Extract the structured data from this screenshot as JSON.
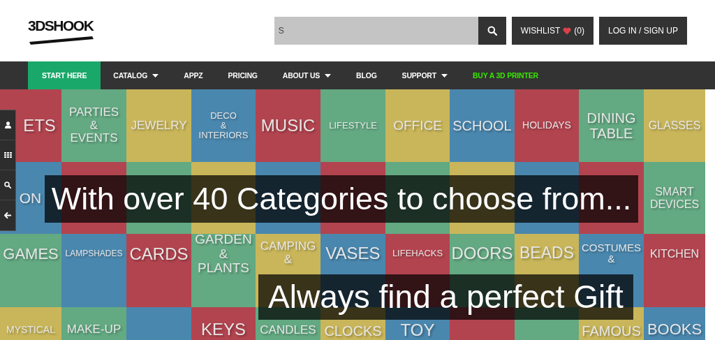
{
  "header": {
    "logo": "3DSHOOK",
    "search": {
      "placeholder": "S"
    },
    "wishlist": {
      "label": "WISHLIST",
      "count": "(0)"
    },
    "login": "LOG IN / SIGN UP"
  },
  "nav": [
    {
      "label": "START HERE",
      "selected": true,
      "dropdown": false,
      "highlight": false
    },
    {
      "label": "CATALOG",
      "selected": false,
      "dropdown": true,
      "highlight": false
    },
    {
      "label": "APPZ",
      "selected": false,
      "dropdown": false,
      "highlight": false
    },
    {
      "label": "PRICING",
      "selected": false,
      "dropdown": false,
      "highlight": false
    },
    {
      "label": "ABOUT US",
      "selected": false,
      "dropdown": true,
      "highlight": false
    },
    {
      "label": "BLOG",
      "selected": false,
      "dropdown": false,
      "highlight": false
    },
    {
      "label": "SUPPORT",
      "selected": false,
      "dropdown": true,
      "highlight": false
    },
    {
      "label": "BUY A 3D PRINTER",
      "selected": false,
      "dropdown": false,
      "highlight": true
    }
  ],
  "hero": {
    "rows": [
      {
        "tiles": [
          {
            "label": "ETS",
            "color": "#b2444f"
          },
          {
            "label": "PARTIES\n&\nEVENTS",
            "color": "#63a982"
          },
          {
            "label": "JEWELRY",
            "color": "#c9b65a"
          },
          {
            "label": "DECO\n&\nINTERIORS",
            "color": "#4a87ae"
          },
          {
            "label": "MUSIC",
            "color": "#b2444f"
          },
          {
            "label": "LIFESTYLE",
            "color": "#63a982"
          },
          {
            "label": "OFFICE",
            "color": "#c9b65a"
          },
          {
            "label": "SCHOOL",
            "color": "#4a87ae"
          },
          {
            "label": "HOLIDAYS",
            "color": "#b2444f"
          },
          {
            "label": "DINING\nTABLE",
            "color": "#63a982"
          },
          {
            "label": "GLASSES",
            "color": "#c9b65a"
          }
        ]
      },
      {
        "tiles": [
          {
            "label": "ON",
            "color": "#4a87ae"
          },
          {
            "color": "#b2444f"
          },
          {
            "color": "#63a982"
          },
          {
            "color": "#c9b65a"
          },
          {
            "color": "#4a87ae"
          },
          {
            "color": "#b2444f"
          },
          {
            "color": "#63a982"
          },
          {
            "color": "#c9b65a"
          },
          {
            "color": "#4a87ae"
          },
          {
            "color": "#b2444f"
          },
          {
            "label": "SMART\nDEVICES",
            "color": "#63a982"
          }
        ]
      },
      {
        "tiles": [
          {
            "label": "GAMES",
            "color": "#63a982"
          },
          {
            "label": "LAMPSHADES",
            "color": "#4a87ae"
          },
          {
            "label": "CARDS",
            "color": "#b2444f"
          },
          {
            "label": "GARDEN\n&\nPLANTS",
            "color": "#63a982"
          },
          {
            "label": "CAMPING\n&",
            "color": "#c9b65a"
          },
          {
            "label": "VASES",
            "color": "#4a87ae"
          },
          {
            "label": "LIFEHACKS",
            "color": "#b2444f"
          },
          {
            "label": "DOORS",
            "color": "#63a982"
          },
          {
            "label": "BEADS",
            "color": "#c9b65a"
          },
          {
            "label": "COSTUMES\n&",
            "color": "#4a87ae"
          },
          {
            "label": "KITCHEN",
            "color": "#b2444f"
          }
        ]
      },
      {
        "tiles": [
          {
            "label": "MYSTICAL",
            "color": "#c9b65a"
          },
          {
            "label": "MAKE-UP",
            "color": "#63a982"
          },
          {
            "color": "#4a87ae"
          },
          {
            "label": "KEYS",
            "color": "#b2444f"
          },
          {
            "label": "CANDLES",
            "color": "#63a982"
          },
          {
            "label": "CLOCKS",
            "color": "#c9b65a"
          },
          {
            "label": "TOY",
            "color": "#4a87ae"
          },
          {
            "color": "#b2444f"
          },
          {
            "color": "#63a982"
          },
          {
            "label": "FAMOUS",
            "color": "#c9b65a"
          },
          {
            "label": "BOOKS",
            "color": "#4a87ae"
          }
        ]
      }
    ],
    "captions": [
      "With over 40 Categories to choose from...",
      "Always find a perfect Gift"
    ]
  }
}
